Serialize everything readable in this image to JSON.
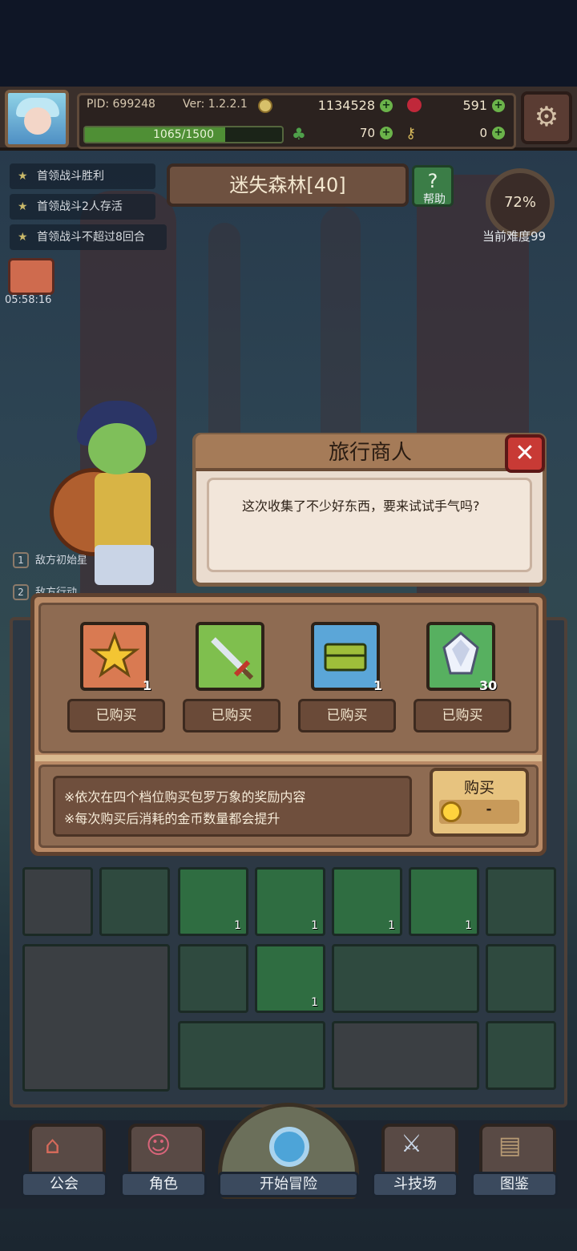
{
  "header": {
    "pid": "PID: 699248",
    "version": "Ver: 1.2.2.1",
    "gold": "1134528",
    "gems": "591",
    "xp": {
      "text": "1065/1500",
      "progress": 0.71
    },
    "clover": "70",
    "keys": "0",
    "icons": {
      "settings": "gear-icon",
      "gold": "coin-icon",
      "gems": "apple-icon",
      "clover": "clover-icon",
      "keys": "key-icon"
    }
  },
  "quests": [
    "首领战斗胜利",
    "首领战斗2人存活",
    "首领战斗不超过8回合"
  ],
  "timer": "05:58:16",
  "stage": {
    "title": "迷失森林[40]",
    "help_label": "帮助",
    "help_glyph": "?",
    "difficulty_percent": "72%",
    "difficulty_label": "当前难度99"
  },
  "background_lines": [
    "敌方初始星",
    "敌方行动"
  ],
  "dialog": {
    "title": "旅行商人",
    "text": "这次收集了不少好东西，要来试试手气吗?",
    "close_glyph": "✕"
  },
  "shop": {
    "items": [
      {
        "icon": "star-icon",
        "count": "1",
        "status": "已购买",
        "color": "#d97a52"
      },
      {
        "icon": "sword-icon",
        "count": "",
        "status": "已购买",
        "color": "#7fbf4e"
      },
      {
        "icon": "chest-icon",
        "count": "1",
        "status": "已购买",
        "color": "#5ba6d8"
      },
      {
        "icon": "crystal-icon",
        "count": "30",
        "status": "已购买",
        "color": "#57b060"
      }
    ],
    "notes": [
      "※依次在四个档位购买包罗万象的奖励内容",
      "※每次购买后消耗的金币数量都会提升"
    ],
    "buy": {
      "label": "购买",
      "price": "-"
    }
  },
  "grid": {
    "counts": [
      "1",
      "1",
      "1",
      "1",
      "1"
    ]
  },
  "nav": {
    "items": [
      {
        "label": "公会",
        "icon": "guild-icon"
      },
      {
        "label": "角色",
        "icon": "character-icon"
      },
      {
        "label": "开始冒险",
        "icon": "magnifier-icon"
      },
      {
        "label": "斗技场",
        "icon": "crossed-swords-icon"
      },
      {
        "label": "图鉴",
        "icon": "book-icon"
      }
    ]
  }
}
